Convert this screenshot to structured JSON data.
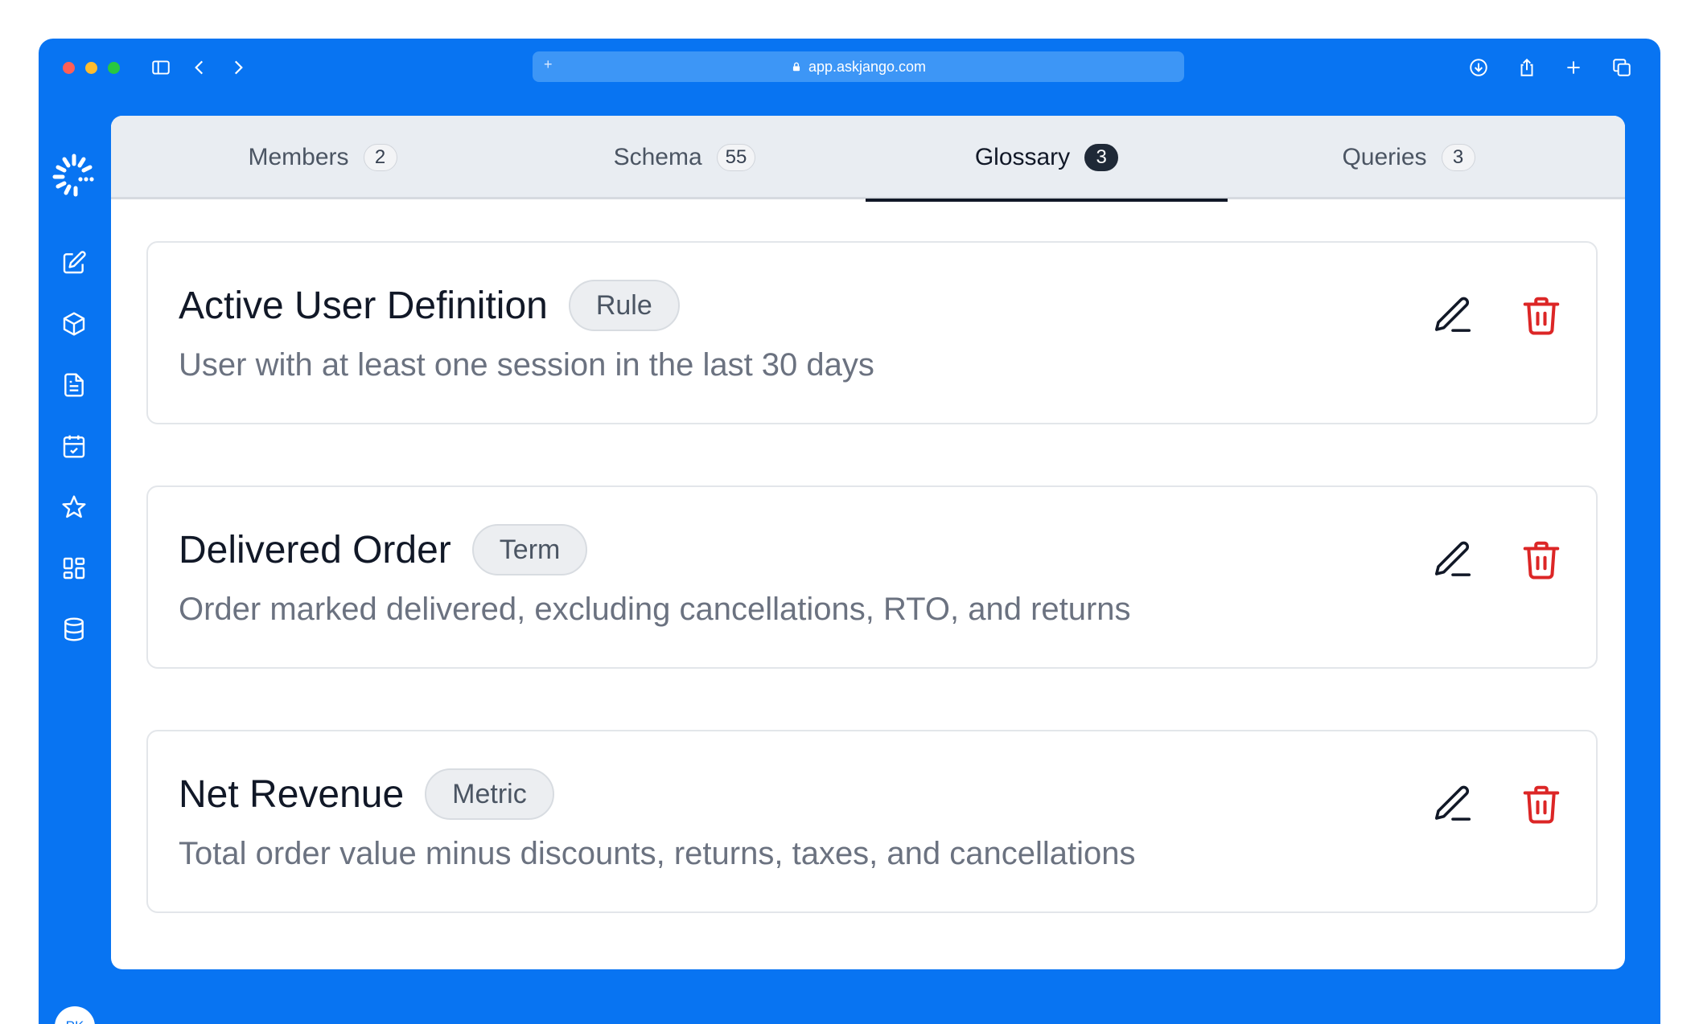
{
  "browser": {
    "url": "app.askjango.com",
    "new_tab_glyph": "+"
  },
  "sidebar": {
    "items": [
      {
        "icon": "edit-square-icon"
      },
      {
        "icon": "cube-icon"
      },
      {
        "icon": "document-icon"
      },
      {
        "icon": "calendar-check-icon"
      },
      {
        "icon": "star-icon"
      },
      {
        "icon": "grid-icon"
      },
      {
        "icon": "database-icon"
      }
    ],
    "avatar_initials": "PK"
  },
  "tabs": [
    {
      "label": "Members",
      "count": "2"
    },
    {
      "label": "Schema",
      "count": "55"
    },
    {
      "label": "Glossary",
      "count": "3",
      "active": true
    },
    {
      "label": "Queries",
      "count": "3"
    }
  ],
  "glossary": [
    {
      "name": "Active User Definition",
      "type": "Rule",
      "description": "User with at least one session in the last 30 days"
    },
    {
      "name": "Delivered Order",
      "type": "Term",
      "description": "Order marked delivered, excluding cancellations, RTO, and returns"
    },
    {
      "name": "Net Revenue",
      "type": "Metric",
      "description": "Total order value minus discounts, returns, taxes, and cancellations"
    }
  ],
  "colors": {
    "brand": "#0874F2",
    "delete": "#DC2626",
    "active_tab": "#111827"
  }
}
